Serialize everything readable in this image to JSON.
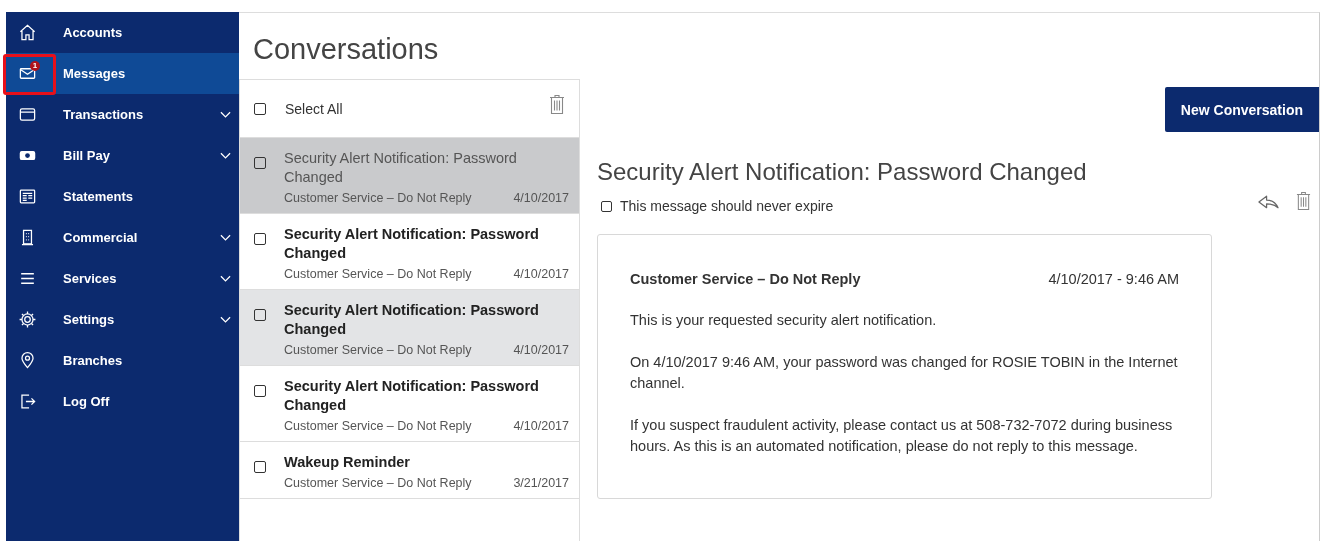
{
  "sidebar": {
    "items": [
      {
        "label": "Accounts",
        "kind": "home",
        "selected": false,
        "expandable": false
      },
      {
        "label": "Messages",
        "kind": "mail",
        "selected": true,
        "expandable": false,
        "badge": "1",
        "highlighted": true
      },
      {
        "label": "Transactions",
        "kind": "card",
        "selected": false,
        "expandable": true
      },
      {
        "label": "Bill Pay",
        "kind": "cash",
        "selected": false,
        "expandable": true
      },
      {
        "label": "Statements",
        "kind": "statement",
        "selected": false,
        "expandable": false
      },
      {
        "label": "Commercial",
        "kind": "building",
        "selected": false,
        "expandable": true
      },
      {
        "label": "Services",
        "kind": "menu",
        "selected": false,
        "expandable": true
      },
      {
        "label": "Settings",
        "kind": "gear",
        "selected": false,
        "expandable": true
      },
      {
        "label": "Branches",
        "kind": "pin",
        "selected": false,
        "expandable": false
      },
      {
        "label": "Log Off",
        "kind": "logout",
        "selected": false,
        "expandable": false
      }
    ]
  },
  "page_title": "Conversations",
  "list": {
    "select_all": {
      "label": "Select All",
      "checked": false
    },
    "rows": [
      {
        "subject": "Security Alert Notification: Password Changed",
        "sender": "Customer Service – Do Not Reply",
        "date": "4/10/2017",
        "checked": false,
        "selected": true,
        "unread": false,
        "highlighted": false
      },
      {
        "subject": "Security Alert Notification: Password Changed",
        "sender": "Customer Service – Do Not Reply",
        "date": "4/10/2017",
        "checked": false,
        "selected": false,
        "unread": true,
        "highlighted": false
      },
      {
        "subject": "Security Alert Notification: Password Changed",
        "sender": "Customer Service – Do Not Reply",
        "date": "4/10/2017",
        "checked": false,
        "selected": false,
        "unread": true,
        "highlighted": true
      },
      {
        "subject": "Security Alert Notification: Password Changed",
        "sender": "Customer Service – Do Not Reply",
        "date": "4/10/2017",
        "checked": false,
        "selected": false,
        "unread": true,
        "highlighted": false
      },
      {
        "subject": "Wakeup Reminder",
        "sender": "Customer Service – Do Not Reply",
        "date": "3/21/2017",
        "checked": false,
        "selected": false,
        "unread": true,
        "highlighted": false
      }
    ]
  },
  "new_button": "New Conversation",
  "detail": {
    "title": "Security Alert Notification: Password Changed",
    "never_expire": {
      "label": "This message should never expire",
      "checked": false
    },
    "message": {
      "sender": "Customer Service – Do Not Reply",
      "timestamp": "4/10/2017 - 9:46 AM",
      "paragraphs": [
        "This is your requested security alert notification.",
        "On 4/10/2017 9:46 AM, your password was changed for ROSIE TOBIN in the Internet channel.",
        "If you suspect fraudulent activity, please contact us at 508-732-7072 during business hours. As this is an automated notification, please do not reply to this message."
      ]
    }
  }
}
